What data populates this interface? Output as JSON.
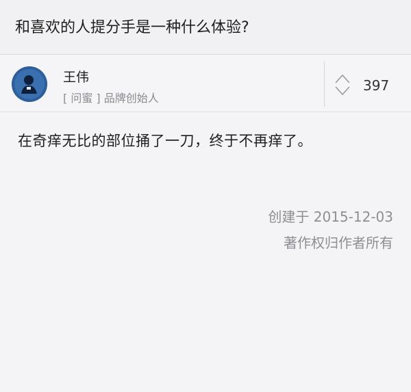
{
  "question": {
    "title": "和喜欢的人提分手是一种什么体验?"
  },
  "author": {
    "name": "王伟",
    "bio": "[ 问蜜 ] 品牌创始人",
    "avatar_icon": "person-avatar-icon"
  },
  "vote": {
    "count": "397",
    "icon": "vote-arrows-icon"
  },
  "answer": {
    "text": "在奇痒无比的部位捅了一刀，终于不再痒了。",
    "created": "创建于 2015-12-03",
    "copyright": "著作权归作者所有"
  },
  "colors": {
    "avatar_bg": "#2f5f9a",
    "meta_text": "#8e8e93",
    "background": "#f4f4f6"
  }
}
